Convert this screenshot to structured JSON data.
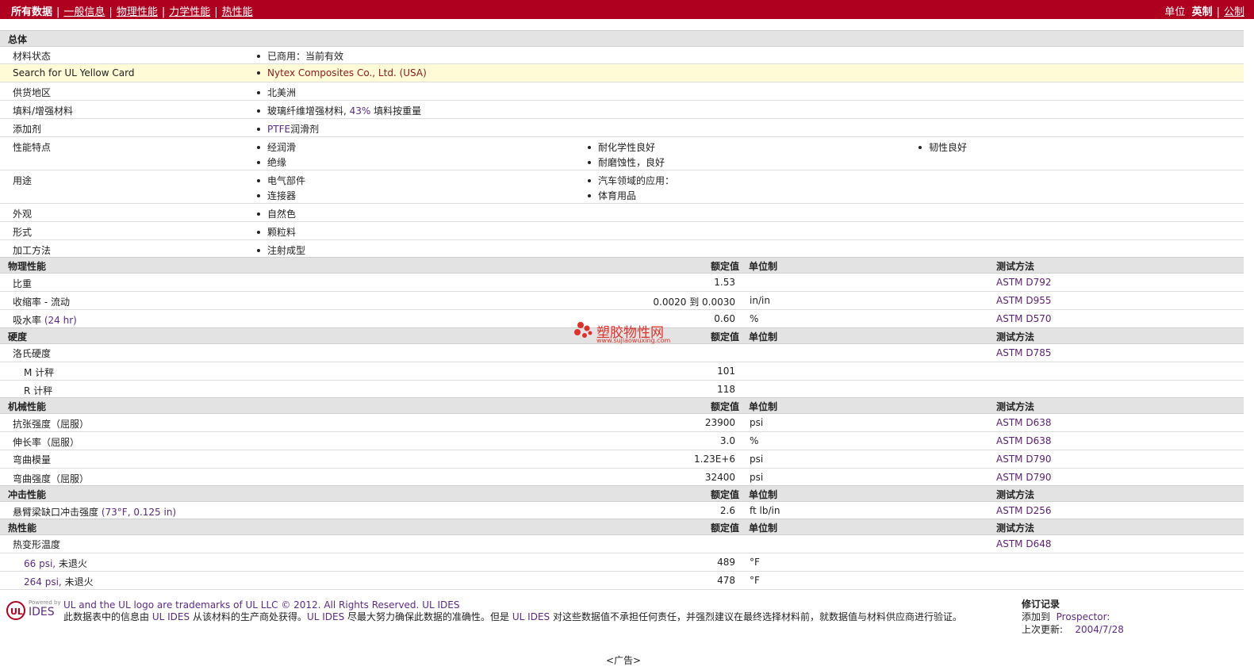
{
  "nav": {
    "all_data": "所有数据",
    "general": "一般信息",
    "physical": "物理性能",
    "mechanical": "力学性能",
    "thermal": "热性能",
    "units_label": "单位",
    "english": "英制",
    "metric": "公制"
  },
  "general": {
    "title": "总体",
    "material_status_label": "材料状态",
    "material_status_value": "已商用：当前有效",
    "yellow_card_label": "Search for UL Yellow Card",
    "yellow_card_value": "Nytex Composites Co., Ltd. (USA)",
    "region_label": "供货地区",
    "region_value": "北美洲",
    "filler_label": "填料/增强材料",
    "filler_value_a": "玻璃纤维增强材料,",
    "filler_value_b": "43%",
    "filler_value_c": "填料按重量",
    "additive_label": "添加剂",
    "additive_value_a": "PTFE",
    "additive_value_b": "润滑剂",
    "features_label": "性能特点",
    "features": [
      "经润滑",
      "耐化学性良好",
      "韧性良好",
      "绝缘",
      "耐磨蚀性，良好"
    ],
    "uses_label": "用途",
    "uses": [
      "电气部件",
      "汽车领域的应用：",
      "连接器",
      "体育用品"
    ],
    "appearance_label": "外观",
    "appearance_value": "自然色",
    "form_label": "形式",
    "form_value": "颗粒料",
    "processing_label": "加工方法",
    "processing_value": "注射成型"
  },
  "headers": {
    "nominal": "额定值",
    "unit": "单位制",
    "test": "测试方法"
  },
  "physical": {
    "title": "物理性能",
    "rows": [
      {
        "label": "比重",
        "value": "1.53",
        "unit": "",
        "method": "ASTM D792"
      },
      {
        "label": "收缩率 - 流动",
        "value": "0.0020 到  0.0030",
        "unit": "in/in",
        "method": "ASTM D955"
      },
      {
        "label": "吸水率",
        "label_extra": "(24 hr)",
        "value": "0.60",
        "unit": "%",
        "method": "ASTM D570"
      }
    ]
  },
  "hardness": {
    "title": "硬度",
    "label": "洛氏硬度",
    "method": "ASTM D785",
    "rows": [
      {
        "label": "M 计秤",
        "value": "101"
      },
      {
        "label": "R 计秤",
        "value": "118"
      }
    ]
  },
  "mechanical": {
    "title": "机械性能",
    "rows": [
      {
        "label": "抗张强度（屈服）",
        "value": "23900",
        "unit": "psi",
        "method": "ASTM D638"
      },
      {
        "label": "伸长率（屈服）",
        "value": "3.0",
        "unit": "%",
        "method": "ASTM D638"
      },
      {
        "label": "弯曲模量",
        "value": "1.23E+6",
        "unit": "psi",
        "method": "ASTM D790"
      },
      {
        "label": "弯曲强度（屈服）",
        "value": "32400",
        "unit": "psi",
        "method": "ASTM D790"
      }
    ]
  },
  "impact": {
    "title": "冲击性能",
    "label": "悬臂梁缺口冲击强度",
    "label_extra": "(73°F, 0.125 in)",
    "value": "2.6",
    "unit": "ft lb/in",
    "method": "ASTM D256"
  },
  "thermal": {
    "title": "热性能",
    "label": "热变形温度",
    "method": "ASTM D648",
    "rows": [
      {
        "label_a": "66 psi,",
        "label_b": "未退火",
        "value": "489",
        "unit": "°F"
      },
      {
        "label_a": "264 psi,",
        "label_b": "未退火",
        "value": "478",
        "unit": "°F"
      }
    ]
  },
  "watermark": {
    "name": "塑胶物性网",
    "url": "www.sujiaowuxing.com"
  },
  "footer": {
    "logo_powered": "Powered by",
    "logo_text": "IDES",
    "trademark": "UL and the UL logo are trademarks of UL LLC © 2012. All Rights Reserved.",
    "ul_ides": "UL IDES",
    "disclaimer_1": "此数据表中的信息由",
    "disclaimer_2": "从该材料的生产商处获得。",
    "disclaimer_3": "尽最大努力确保此数据的准确性。但是",
    "disclaimer_4": "对这些数据值不承担任何责任，并强烈建议在最终选择材料前，就数据值与材料供应商进行验证。",
    "rev_title": "修订记录",
    "rev_added_label": "添加到",
    "rev_added_value": "Prospector:",
    "rev_updated_label": "上次更新:",
    "rev_updated_value": "2004/7/28",
    "ad": "<广告>"
  }
}
